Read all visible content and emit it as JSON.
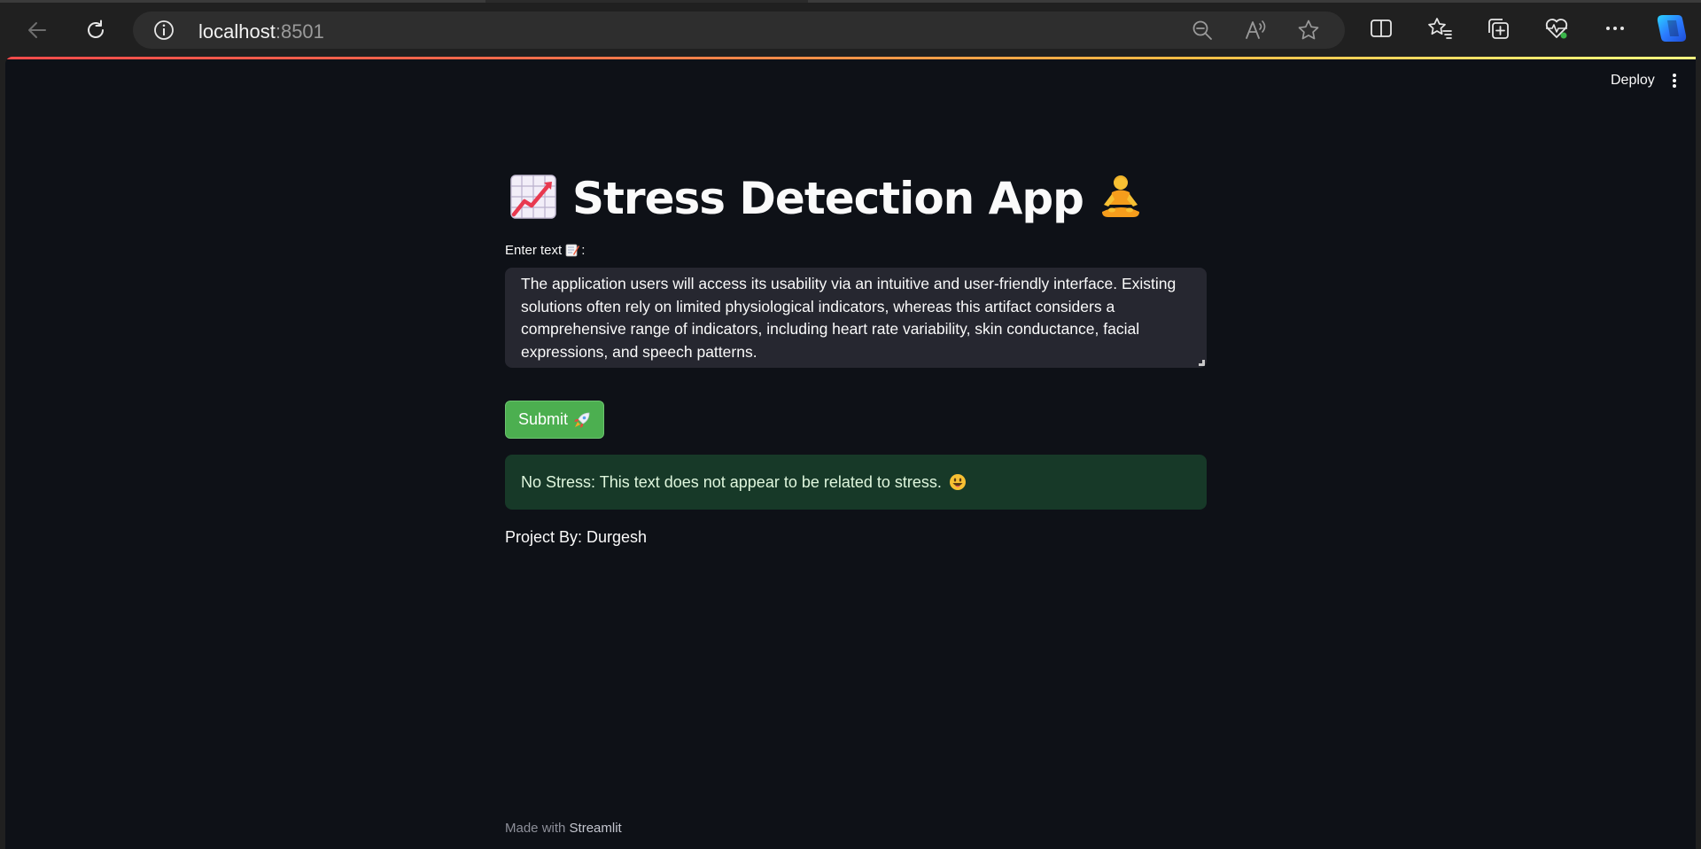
{
  "browser": {
    "url_host": "localhost",
    "url_port": ":8501"
  },
  "toolbar": {
    "deploy_label": "Deploy"
  },
  "app": {
    "title": "Stress Detection App",
    "input_label": "Enter text",
    "input_label_suffix": ":",
    "input_value": "The application users will access its usability via an intuitive and user-friendly interface. Existing solutions often rely on limited physiological indicators, whereas this artifact considers a comprehensive range of indicators, including heart rate variability, skin conductance, facial expressions, and speech patterns.",
    "submit_label": "Submit",
    "result_text": "No Stress: This text does not appear to be related to stress.",
    "credit": "Project By: Durgesh"
  },
  "footer": {
    "made_with": "Made with",
    "brand": "Streamlit"
  },
  "colors": {
    "page_bg": "#0e1117",
    "textarea_bg": "#262730",
    "submit_green": "#4caf50",
    "success_bg": "#173928",
    "chrome_bg": "#202020"
  },
  "icons": {
    "back": "arrow-left-icon",
    "reload": "reload-icon",
    "site_info": "info-icon",
    "zoom_out": "zoom-out-icon",
    "read_aloud": "read-aloud-icon",
    "favorite": "star-icon",
    "split_screen": "split-screen-icon",
    "favorites": "favorites-icon",
    "collections": "collections-icon",
    "health": "heartbeat-icon",
    "more": "more-icon",
    "copilot": "copilot-icon",
    "chart_emoji": "chart-increasing-icon",
    "lotus_emoji": "person-lotus-icon",
    "memo_emoji": "memo-icon",
    "rocket_emoji": "rocket-icon",
    "smile_emoji": "smiley-icon"
  }
}
